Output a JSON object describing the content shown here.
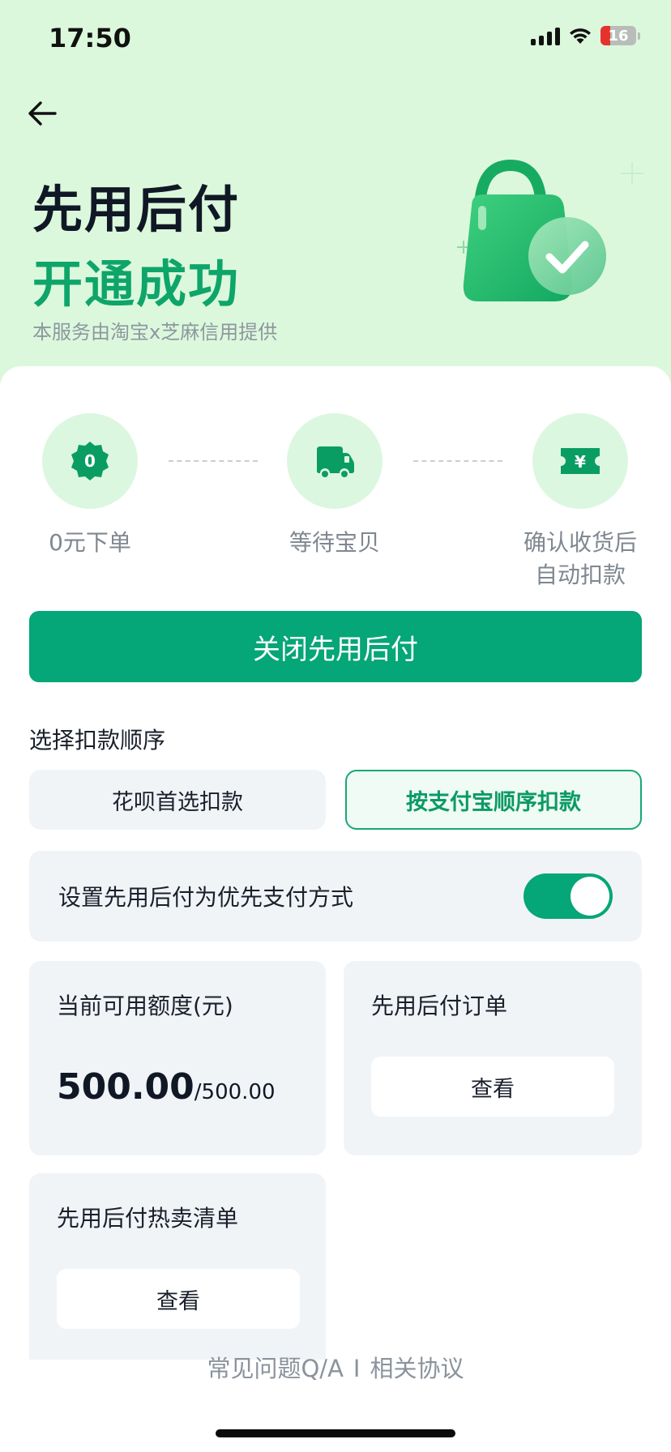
{
  "status_bar": {
    "time": "17:50",
    "battery": "16"
  },
  "header": {
    "title_line1": "先用后付",
    "title_line2": "开通成功",
    "provider": "本服务由淘宝x芝麻信用提供"
  },
  "steps": [
    {
      "label": "0元下单",
      "icon": "zero-badge-icon",
      "badge": "0"
    },
    {
      "label": "等待宝贝",
      "icon": "truck-icon"
    },
    {
      "label": "确认收货后自动扣款",
      "label_line1": "确认收货后",
      "label_line2": "自动扣款",
      "icon": "ticket-icon",
      "badge": "¥"
    }
  ],
  "primary_button": "关闭先用后付",
  "deduction": {
    "title": "选择扣款顺序",
    "options": [
      "花呗首选扣款",
      "按支付宝顺序扣款"
    ],
    "selected": "按支付宝顺序扣款"
  },
  "preference": {
    "label": "设置先用后付为优先支付方式",
    "enabled": true
  },
  "quota": {
    "title": "当前可用额度(元)",
    "available": "500.00",
    "total": "/500.00"
  },
  "orders": {
    "title": "先用后付订单",
    "button": "查看"
  },
  "hot_list": {
    "title": "先用后付热卖清单",
    "button": "查看"
  },
  "footer": {
    "faq": "常见问题Q/A",
    "separator": "I",
    "agreement": "相关协议"
  },
  "colors": {
    "accent": "#05a677",
    "hero_bg": "#dcf8dc",
    "title_green": "#0ea56a"
  }
}
